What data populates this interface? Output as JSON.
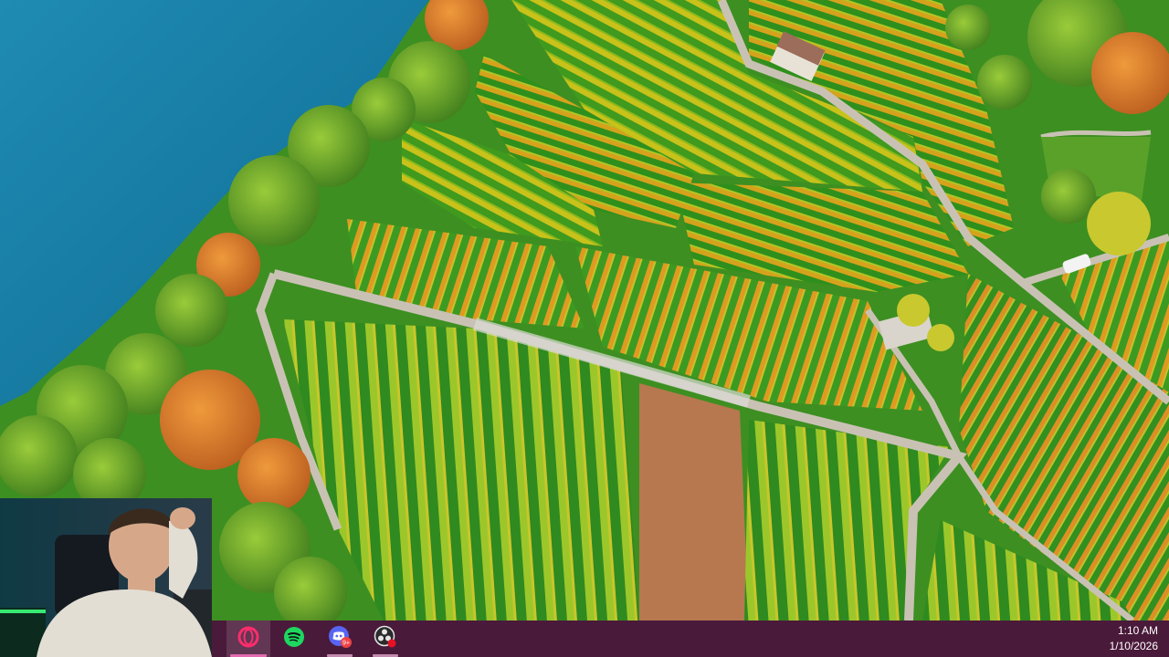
{
  "desktop": {
    "wallpaper_description_icon": "vineyard-wallpaper"
  },
  "webcam": {
    "icon": "webcam-overlay"
  },
  "taskbar": {
    "accent_color": "#e36bb0",
    "background_color": "#4a1a3a",
    "apps": [
      {
        "name": "Opera GX",
        "icon": "opera-icon",
        "active": true
      },
      {
        "name": "Spotify",
        "icon": "spotify-icon",
        "active": false
      },
      {
        "name": "Discord",
        "icon": "discord-icon",
        "active": false,
        "badge": "9+"
      },
      {
        "name": "OBS Studio",
        "icon": "obs-icon",
        "active": false
      }
    ],
    "clock": {
      "time": "1:10 AM",
      "date": "1/10/2026"
    }
  }
}
